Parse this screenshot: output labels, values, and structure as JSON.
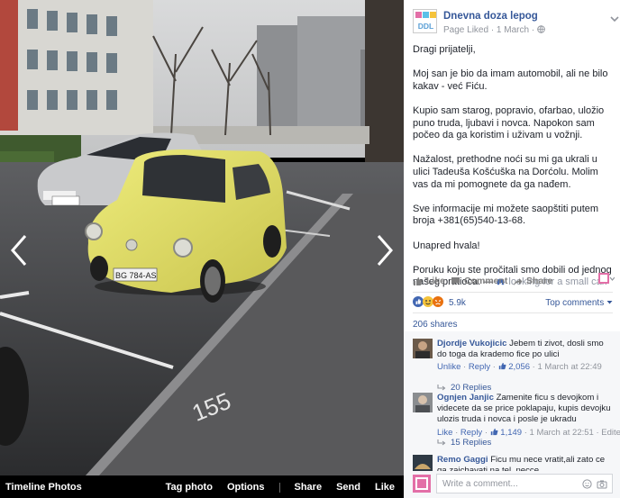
{
  "viewer": {
    "bottom_left": "Timeline Photos",
    "actions": [
      "Tag photo",
      "Options",
      "Share",
      "Send",
      "Like"
    ],
    "plate_text": "BG 784-AS",
    "street_number": "155"
  },
  "post": {
    "page_name": "Dnevna doza lepog",
    "avatar_text": "DDL",
    "meta": "Page Liked · 1 March ·",
    "paragraphs": [
      "Dragi prijatelji,",
      "Moj san je bio da imam automobil, ali ne bilo kakav - već Fiću.",
      "Kupio sam starog, popravio, ofarbao, uložio puno truda, ljubavi i novca. Napokon sam počeo da ga koristim i uživam u vožnji.",
      "Nažalost, prethodne noći su mi ga ukrali u ulici Tadeuša Košćuška na Dorćolu. Molim vas da mi pomognete da ga nađem.",
      "Sve informacije mi možete saopštiti putem broja +381(65)540-13-68.",
      "Unapred hvala!"
    ],
    "last_paragraph": "Poruku koju ste pročitali smo dobili od jednog našeg pratioca. —",
    "feeling_text": "looking for a small car."
  },
  "actions": {
    "like": "Like",
    "comment": "Comment",
    "share": "Share"
  },
  "reactions": {
    "count": "5.9k",
    "top_comments": "Top comments"
  },
  "shares": "206 shares",
  "comments": [
    {
      "name": "Djordje Vukojicic",
      "text": "Jebem ti zivot, dosli smo do toga da krademo fice po ulici",
      "unlike": "Unlike",
      "reply": "Reply",
      "likes": "2,056",
      "time": "1 March at 22:49",
      "edited": "",
      "replies": "20 Replies"
    },
    {
      "name": "Ognjen Janjic",
      "text": "Zamenite ficu s devojkom i videcete da se price poklapaju, kupis devojku ulozis truda i novca i posle je ukradu",
      "unlike": "Like",
      "reply": "Reply",
      "likes": "1,149",
      "time": "1 March at 22:51",
      "edited": "Edited",
      "replies": "15 Replies"
    },
    {
      "name": "Remo Gaggi",
      "text": "Ficu mu nece vratit,ali zato ce ga zaichavati na tel. necce"
    }
  ],
  "write_comment": {
    "placeholder": "Write a comment..."
  },
  "colors": {
    "link": "#365899",
    "meta": "#90949c",
    "car": "#e8e56a"
  }
}
